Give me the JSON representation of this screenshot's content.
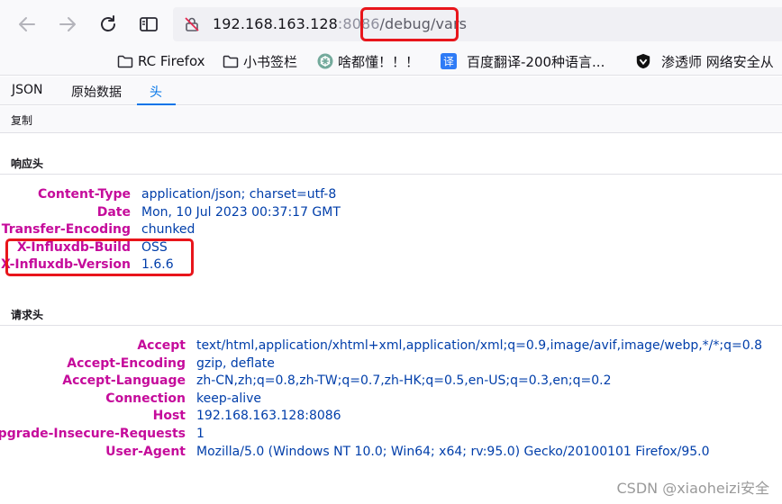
{
  "browser": {
    "url_host": "192.168.163.128",
    "url_port": ":8086",
    "url_path": "/debug/vars",
    "bookmarks": [
      {
        "label": "RC Firefox",
        "icon": "folder-icon"
      },
      {
        "label": "小书签栏",
        "icon": "folder-icon"
      },
      {
        "label": "啥都懂！！！",
        "icon": "openai-icon"
      },
      {
        "label": "百度翻译-200种语言...",
        "icon": "baidu-translate-icon"
      },
      {
        "label": "渗透师 网络安全从",
        "icon": "shield-icon"
      }
    ]
  },
  "viewer": {
    "tabs": [
      {
        "label": "JSON"
      },
      {
        "label": "原始数据"
      },
      {
        "label": "头"
      }
    ],
    "active_tab": "头",
    "copy_label": "复制",
    "response_section": {
      "title": "响应头",
      "headers": [
        {
          "name": "Content-Type",
          "value": "application/json; charset=utf-8"
        },
        {
          "name": "Date",
          "value": "Mon, 10 Jul 2023 00:37:17 GMT"
        },
        {
          "name": "Transfer-Encoding",
          "value": "chunked"
        },
        {
          "name": "X-Influxdb-Build",
          "value": "OSS"
        },
        {
          "name": "X-Influxdb-Version",
          "value": "1.6.6"
        }
      ]
    },
    "request_section": {
      "title": "请求头",
      "headers": [
        {
          "name": "Accept",
          "value": "text/html,application/xhtml+xml,application/xml;q=0.9,image/avif,image/webp,*/*;q=0.8"
        },
        {
          "name": "Accept-Encoding",
          "value": "gzip, deflate"
        },
        {
          "name": "Accept-Language",
          "value": "zh-CN,zh;q=0.8,zh-TW;q=0.7,zh-HK;q=0.5,en-US;q=0.3,en;q=0.2"
        },
        {
          "name": "Connection",
          "value": "keep-alive"
        },
        {
          "name": "Host",
          "value": "192.168.163.128:8086"
        },
        {
          "name": "Upgrade-Insecure-Requests",
          "value": "1"
        },
        {
          "name": "User-Agent",
          "value": "Mozilla/5.0 (Windows NT 10.0; Win64; x64; rv:95.0) Gecko/20100101 Firefox/95.0"
        }
      ]
    }
  },
  "watermark": "CSDN @xiaoheizi安全",
  "colors": {
    "highlight_red": "#e8151b",
    "header_name": "#c50b9b",
    "header_value": "#003eaa",
    "active_tab": "#0074e8"
  }
}
